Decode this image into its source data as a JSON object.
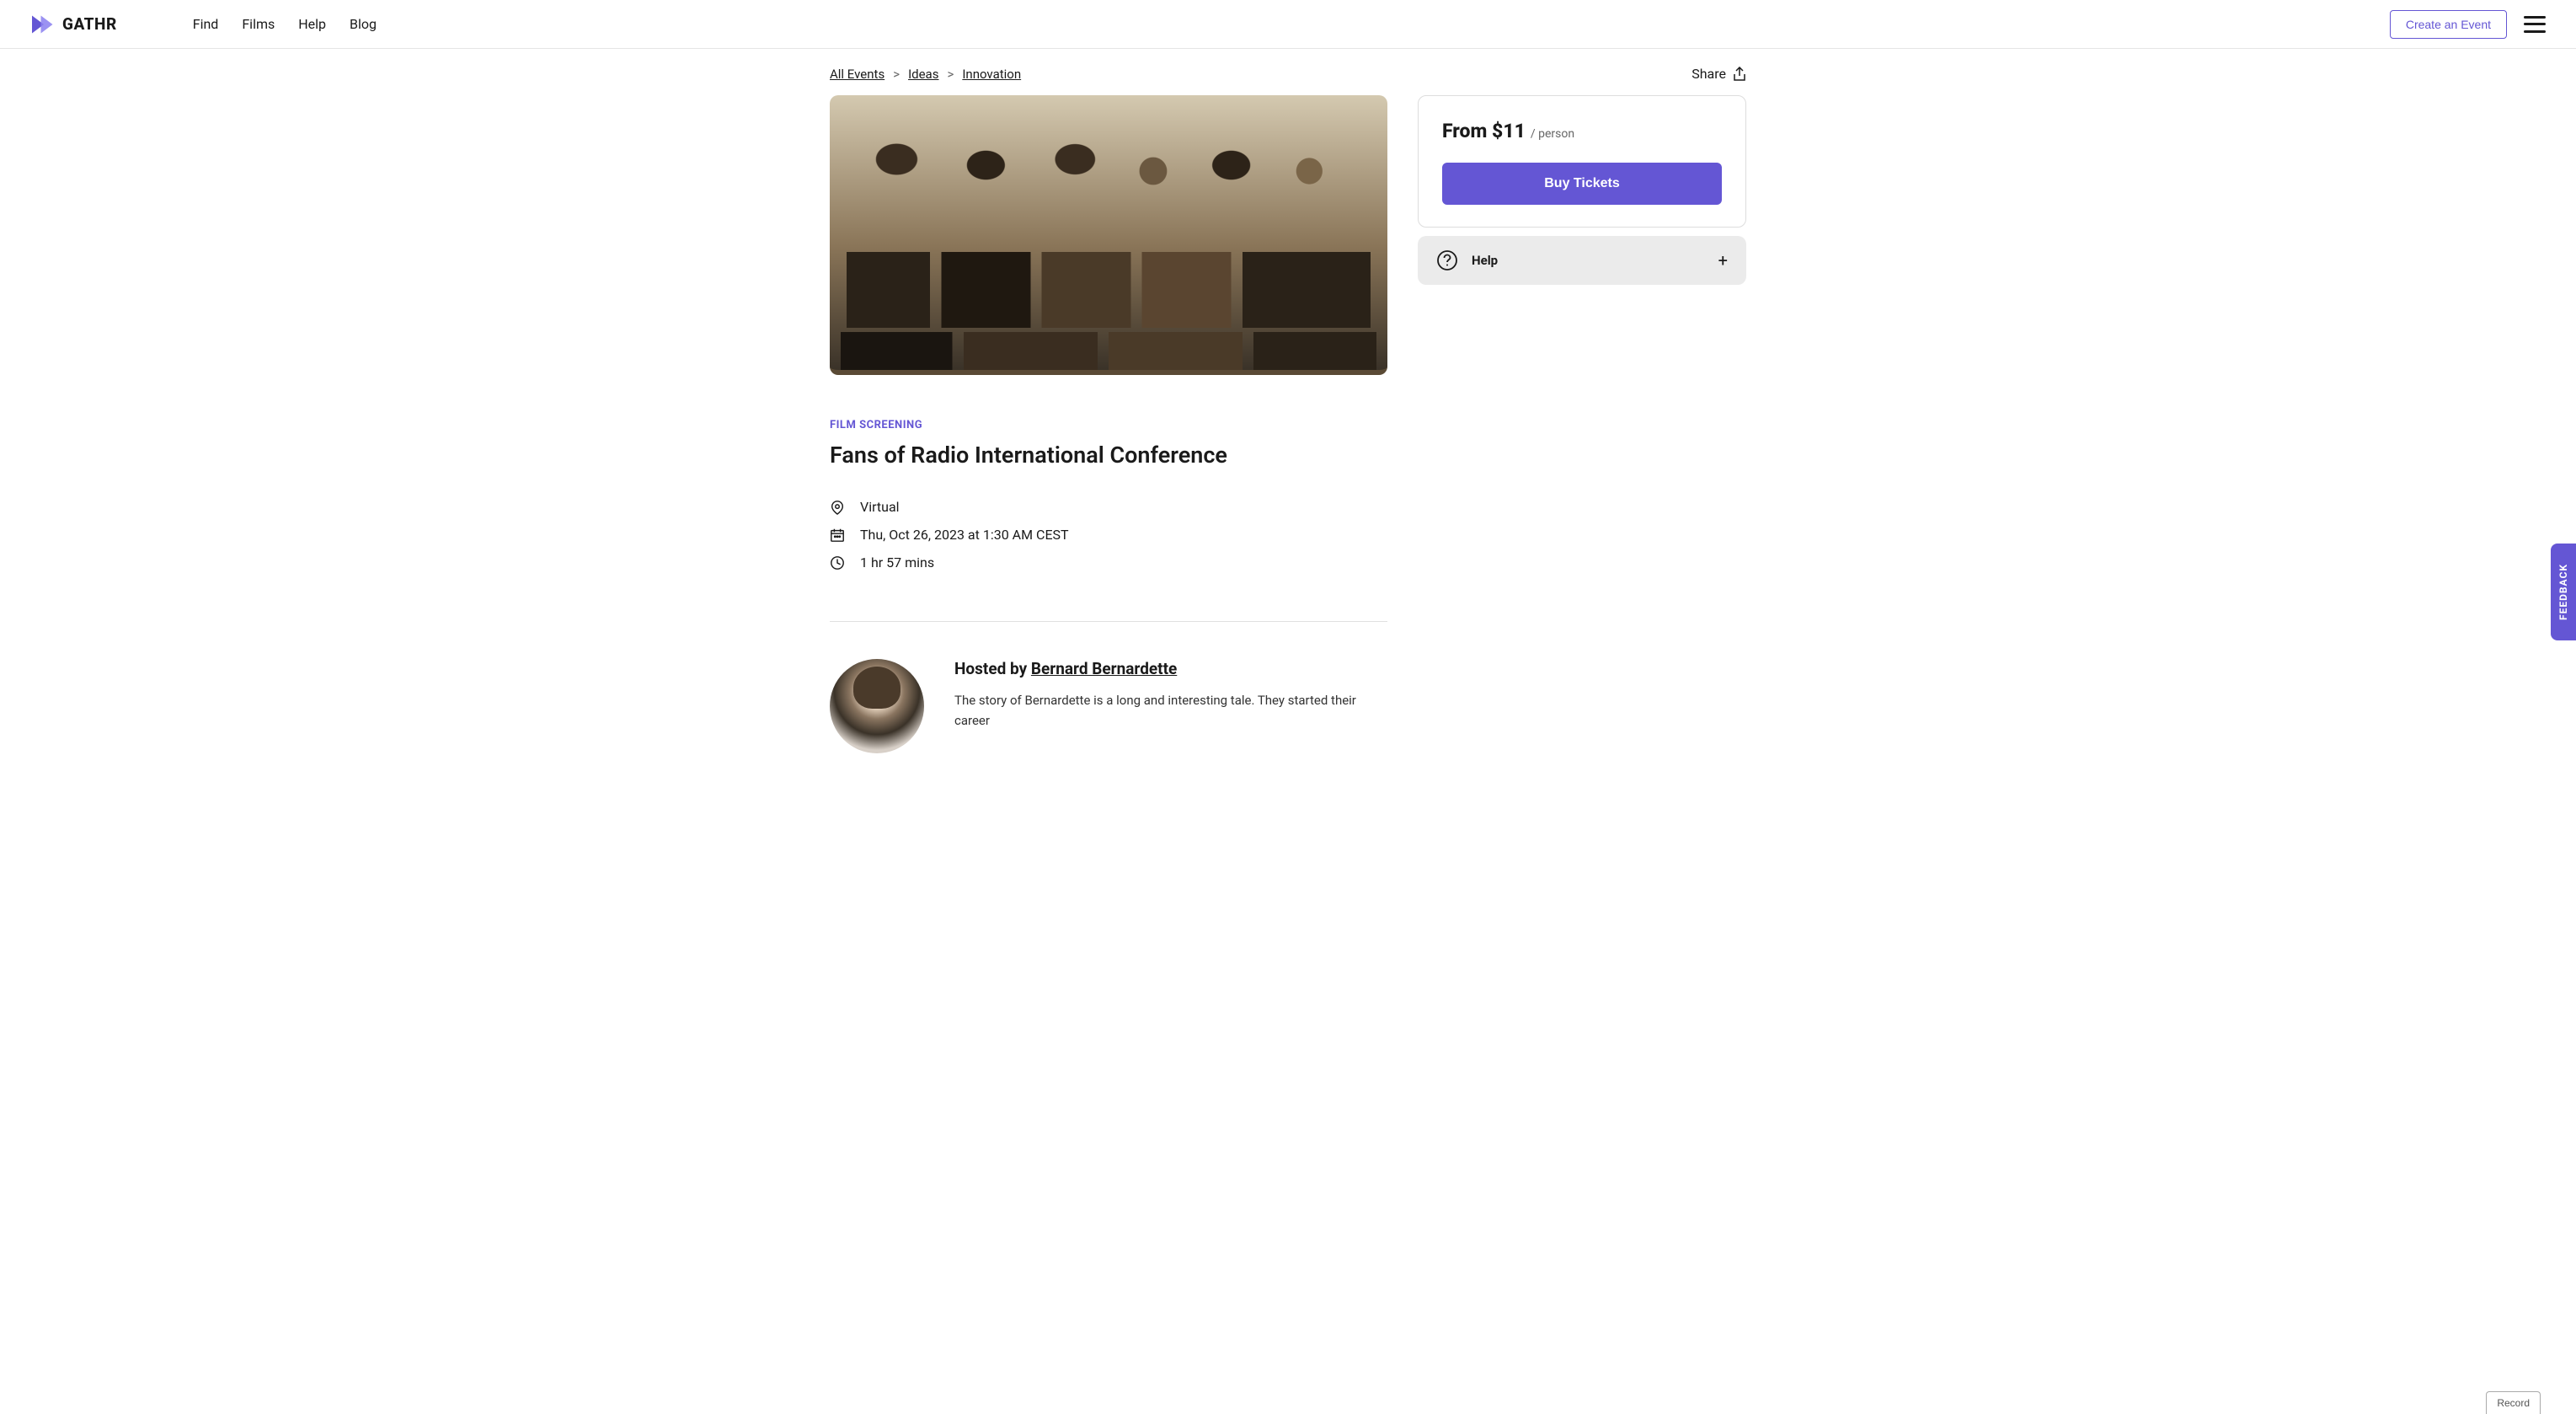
{
  "brand": "GATHR",
  "nav": {
    "find": "Find",
    "films": "Films",
    "help": "Help",
    "blog": "Blog"
  },
  "header": {
    "create_event": "Create an Event"
  },
  "breadcrumb": {
    "all_events": "All Events",
    "ideas": "Ideas",
    "innovation": "Innovation",
    "sep": ">"
  },
  "share_label": "Share",
  "event": {
    "type": "FILM SCREENING",
    "title": "Fans of Radio International Conference",
    "location": "Virtual",
    "datetime": "Thu, Oct 26, 2023 at 1:30 AM CEST",
    "duration": "1 hr 57 mins"
  },
  "ticket": {
    "price": "From $11",
    "per": "/ person",
    "buy_label": "Buy Tickets"
  },
  "help_panel": {
    "label": "Help",
    "plus": "+"
  },
  "host": {
    "prefix": "Hosted by ",
    "name": "Bernard Bernardette",
    "bio": "The story of Bernardette is a long and interesting tale. They started their career"
  },
  "feedback": "FEEDBACK",
  "record": "Record"
}
